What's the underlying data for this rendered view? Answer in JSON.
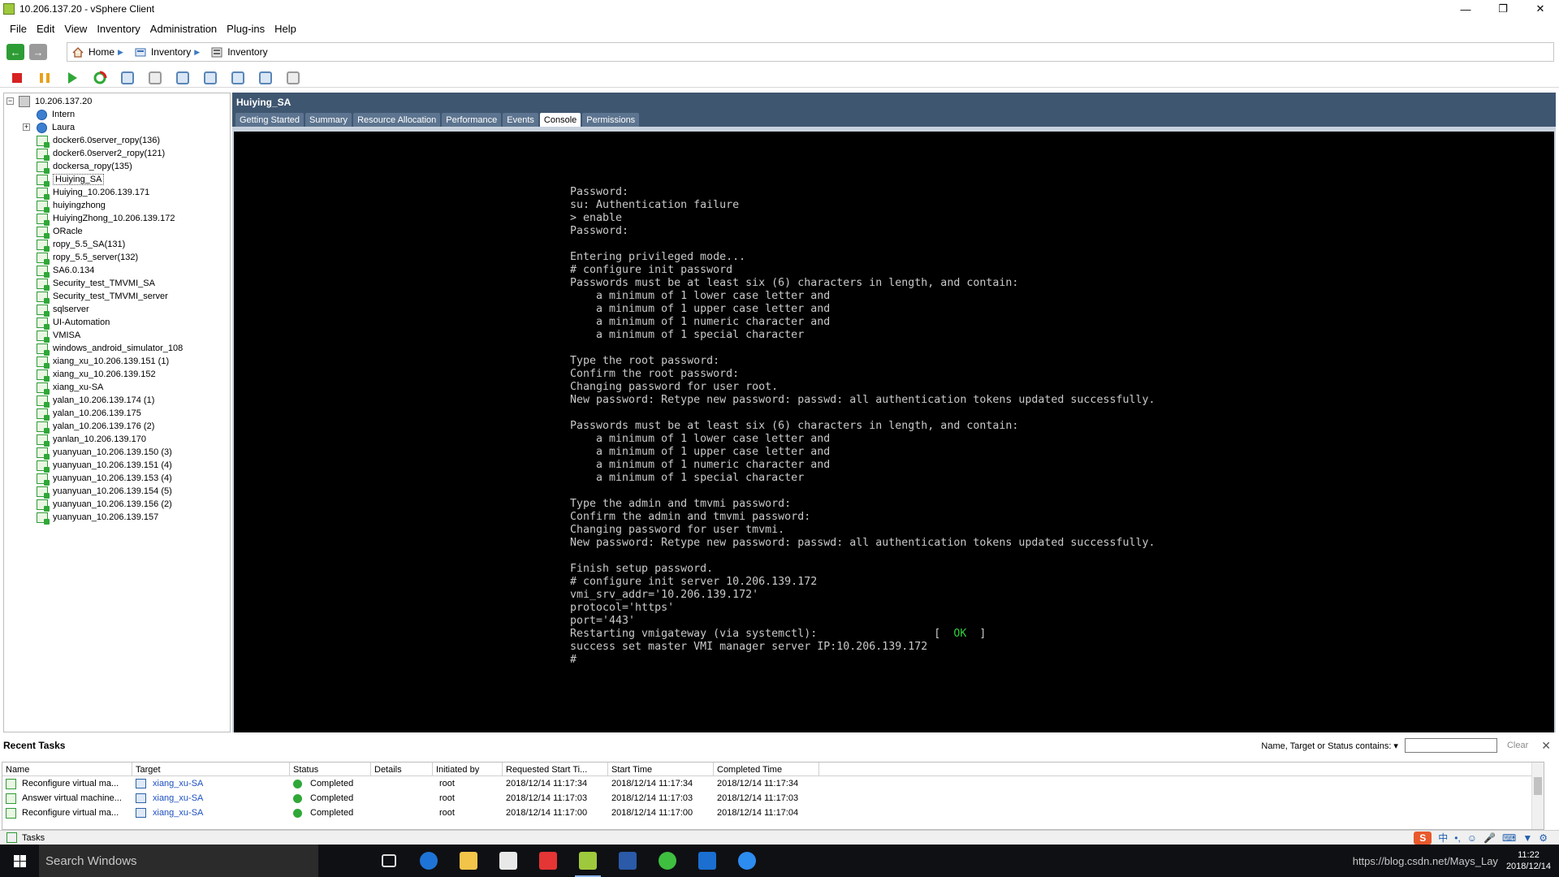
{
  "window": {
    "title": "10.206.137.20 - vSphere Client"
  },
  "menu": [
    "File",
    "Edit",
    "View",
    "Inventory",
    "Administration",
    "Plug-ins",
    "Help"
  ],
  "breadcrumb": [
    "Home",
    "Inventory",
    "Inventory"
  ],
  "tree": {
    "root": "10.206.137.20",
    "pools": [
      "Intern",
      "Laura"
    ],
    "vms": [
      "docker6.0server_ropy(136)",
      "docker6.0server2_ropy(121)",
      "dockersa_ropy(135)",
      "Huiying_SA",
      "Huiying_10.206.139.171",
      "huiyingzhong",
      "HuiyingZhong_10.206.139.172",
      "ORacle",
      "ropy_5.5_SA(131)",
      "ropy_5.5_server(132)",
      "SA6.0.134",
      "Security_test_TMVMI_SA",
      "Security_test_TMVMI_server",
      "sqlserver",
      "UI-Automation",
      "VMISA",
      "windows_android_simulator_108",
      "xiang_xu_10.206.139.151 (1)",
      "xiang_xu_10.206.139.152",
      "xiang_xu-SA",
      "yalan_10.206.139.174 (1)",
      "yalan_10.206.139.175",
      "yalan_10.206.139.176 (2)",
      "yanlan_10.206.139.170",
      "yuanyuan_10.206.139.150 (3)",
      "yuanyuan_10.206.139.151 (4)",
      "yuanyuan_10.206.139.153 (4)",
      "yuanyuan_10.206.139.154 (5)",
      "yuanyuan_10.206.139.156 (2)",
      "yuanyuan_10.206.139.157"
    ],
    "selected": "Huiying_SA"
  },
  "vm": {
    "name": "Huiying_SA",
    "tabs": [
      "Getting Started",
      "Summary",
      "Resource Allocation",
      "Performance",
      "Events",
      "Console",
      "Permissions"
    ],
    "active_tab": "Console"
  },
  "console": {
    "lines_before_ok": "Password:\nsu: Authentication failure\n> enable\nPassword:\n\nEntering privileged mode...\n# configure init password\nPasswords must be at least six (6) characters in length, and contain:\n    a minimum of 1 lower case letter and\n    a minimum of 1 upper case letter and\n    a minimum of 1 numeric character and\n    a minimum of 1 special character\n\nType the root password:\nConfirm the root password:\nChanging password for user root.\nNew password: Retype new password: passwd: all authentication tokens updated successfully.\n\nPasswords must be at least six (6) characters in length, and contain:\n    a minimum of 1 lower case letter and\n    a minimum of 1 upper case letter and\n    a minimum of 1 numeric character and\n    a minimum of 1 special character\n\nType the admin and tmvmi password:\nConfirm the admin and tmvmi password:\nChanging password for user tmvmi.\nNew password: Retype new password: passwd: all authentication tokens updated successfully.\n\nFinish setup password.\n# configure init server 10.206.139.172\nvmi_srv_addr='10.206.139.172'\nprotocol='https'\nport='443'\nRestarting vmigateway (via systemctl):                  [  ",
    "ok": "OK",
    "lines_after_ok": "  ]\nsuccess set master VMI manager server IP:10.206.139.172\n#"
  },
  "tasks": {
    "title": "Recent Tasks",
    "filter_label": "Name, Target or Status contains: ▾",
    "clear": "Clear",
    "columns": [
      "Name",
      "Target",
      "Status",
      "Details",
      "Initiated by",
      "Requested Start Ti...",
      "Start Time",
      "Completed Time"
    ],
    "rows": [
      {
        "name": "Reconfigure virtual ma...",
        "target": "xiang_xu-SA",
        "status": "Completed",
        "details": "",
        "by": "root",
        "req": "2018/12/14 11:17:34",
        "start": "2018/12/14 11:17:34",
        "done": "2018/12/14 11:17:34"
      },
      {
        "name": "Answer virtual machine...",
        "target": "xiang_xu-SA",
        "status": "Completed",
        "details": "",
        "by": "root",
        "req": "2018/12/14 11:17:03",
        "start": "2018/12/14 11:17:03",
        "done": "2018/12/14 11:17:03"
      },
      {
        "name": "Reconfigure virtual ma...",
        "target": "xiang_xu-SA",
        "status": "Completed",
        "details": "",
        "by": "root",
        "req": "2018/12/14 11:17:00",
        "start": "2018/12/14 11:17:00",
        "done": "2018/12/14 11:17:04"
      }
    ]
  },
  "statusbar": {
    "tasks_label": "Tasks",
    "ime_s": "S",
    "ime_mode": "中"
  },
  "taskbar": {
    "search_placeholder": "Search Windows",
    "overlay": "https://blog.csdn.net/Mays_Lay",
    "time": "11:22",
    "date": "2018/12/14"
  }
}
